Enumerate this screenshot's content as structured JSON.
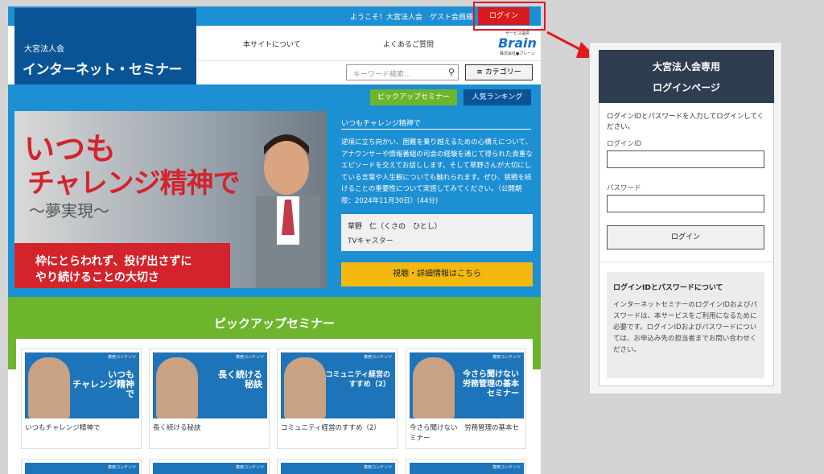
{
  "site": {
    "welcome": "ようこそ！大宮法人会　ゲスト会員様",
    "login_button": "ログイン",
    "org_name": "大宮法人会",
    "site_title": "インターネット・セミナー",
    "nav": [
      "本サイトについて",
      "よくあるご質問"
    ],
    "brain": {
      "small": "サービス提供",
      "logo": "Brain",
      "company": "株式会社●ブレーン"
    },
    "search_placeholder": "キーワード検索...",
    "category_button": "≡ カテゴリー",
    "pickup_button": "ピックアップセミナー",
    "ranking_button": "人気ランキング"
  },
  "hero": {
    "line1": "いつも",
    "line2": "チャレンジ精神で",
    "line3": "～夢実現～",
    "band1": "枠にとらわれず、投げ出さずに",
    "band2": "やり続けることの大切さ"
  },
  "feature": {
    "title": "いつもチャレンジ精神で",
    "body": "逆境に立ち向かい、困難を乗り越えるための心構えについて、アナウンサーや情報番組の司会の経験を通じて得られた貴重なエピソードを交えてお話しします。そして草野さんが大切にしている言葉や人生観についても触れられます。ぜひ、挑戦を続けることの重要性について実感してみてください。（公開期限：2024年11月30日）(44分)",
    "presenter_name": "草野　仁（くさの　ひとし）",
    "presenter_role": "TVキャスター",
    "watch_button": "視聴・詳細情報はこちら"
  },
  "pickup_heading": "ピックアップセミナー",
  "cards": [
    {
      "tag": "専用コンテンツ",
      "thumb_text": "いつも\nチャレンジ精神で",
      "caption": "いつもチャレンジ精神で"
    },
    {
      "tag": "専用コンテンツ",
      "thumb_text": "長く続ける\n秘訣",
      "caption": "長く続ける秘訣"
    },
    {
      "tag": "専用コンテンツ",
      "thumb_text": "コミュニティ経営の\nすすめ（2）",
      "caption": "コミュニティ経営のすすめ（2）"
    },
    {
      "tag": "専用コンテンツ",
      "thumb_text": "今さら聞けない\n労務管理の基本\nセミナー",
      "caption": "今さら聞けない　労務管理の基本セミナー"
    }
  ],
  "login_panel": {
    "head1": "大宮法人会専用",
    "head2": "ログインページ",
    "intro": "ログインIDとパスワードを入力してログインしてください。",
    "id_label": "ログインID",
    "pw_label": "パスワード",
    "login_button": "ログイン",
    "about_heading": "ログインIDとパスワードについて",
    "about_body": "インターネットセミナーのログインIDおよびパスワードは、本サービスをご利用になるために必要です。ログインIDおよびパスワードについては、お申込み先の担当者までお問い合わせください。"
  },
  "colors": {
    "accent_blue": "#1d8fd3",
    "navy": "#0a5496",
    "green": "#6db52c",
    "red": "#d91b1b",
    "yellow": "#f4b80e"
  }
}
